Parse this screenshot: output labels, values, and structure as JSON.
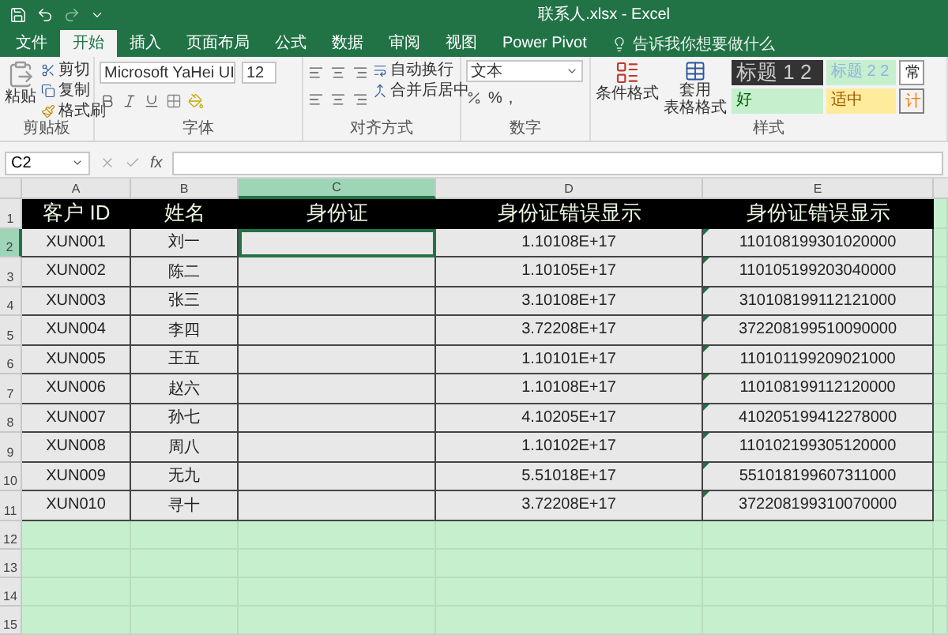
{
  "title_bar": {
    "title": "联系人.xlsx  -  Excel"
  },
  "tabs": [
    {
      "label": "文件",
      "selected": false
    },
    {
      "label": "开始",
      "selected": true
    },
    {
      "label": "插入",
      "selected": false
    },
    {
      "label": "页面布局",
      "selected": false
    },
    {
      "label": "公式",
      "selected": false
    },
    {
      "label": "数据",
      "selected": false
    },
    {
      "label": "审阅",
      "selected": false
    },
    {
      "label": "视图",
      "selected": false
    },
    {
      "label": "Power Pivot",
      "selected": false
    }
  ],
  "tell_me": {
    "placeholder": "告诉我你想要做什么"
  },
  "ribbon": {
    "clipboard": {
      "paste": "粘贴",
      "cut": "剪切",
      "copy": "复制",
      "format_painter": "格式刷",
      "label": "剪贴板"
    },
    "font": {
      "name": "Microsoft YaHei UI",
      "size": "12",
      "label": "字体"
    },
    "alignment": {
      "wrap": "自动换行",
      "merge": "合并后居中",
      "label": "对齐方式"
    },
    "number": {
      "format": "文本",
      "percent": "%",
      "comma": ",",
      "label": "数字"
    },
    "styles": {
      "conditional": "条件格式",
      "table_format": [
        "套用",
        "表格格式"
      ],
      "label": "样式",
      "cells": [
        {
          "label": "标题 1 2",
          "kind": "heading1"
        },
        {
          "label": "标题 2 2",
          "kind": "heading2"
        },
        {
          "label": "常",
          "kind": "normal"
        },
        {
          "label": "好",
          "kind": "good"
        },
        {
          "label": "适中",
          "kind": "neutral"
        },
        {
          "label": "计",
          "kind": "calc"
        }
      ]
    }
  },
  "formula_bar": {
    "name_box": "C2",
    "fx": "fx"
  },
  "sheet": {
    "columns": [
      {
        "label": "A",
        "selected": false
      },
      {
        "label": "B",
        "selected": false
      },
      {
        "label": "C",
        "selected": true
      },
      {
        "label": "D",
        "selected": false
      },
      {
        "label": "E",
        "selected": false
      }
    ],
    "header": {
      "number": "1",
      "cells": [
        "客户 ID",
        "姓名",
        "身份证",
        "身份证错误显示",
        "身份证错误显示"
      ]
    },
    "rows": [
      {
        "number": "2",
        "selected": true,
        "customer_id": "XUN001",
        "name": "刘一",
        "shown_d": "1.10108E+17",
        "shown_e": "110108199301020000",
        "error_flag": true
      },
      {
        "number": "3",
        "selected": false,
        "customer_id": "XUN002",
        "name": "陈二",
        "shown_d": "1.10105E+17",
        "shown_e": "110105199203040000",
        "error_flag": true
      },
      {
        "number": "4",
        "selected": false,
        "customer_id": "XUN003",
        "name": "张三",
        "shown_d": "3.10108E+17",
        "shown_e": "310108199112121000",
        "error_flag": true
      },
      {
        "number": "5",
        "selected": false,
        "customer_id": "XUN004",
        "name": "李四",
        "shown_d": "3.72208E+17",
        "shown_e": "372208199510090000",
        "error_flag": true
      },
      {
        "number": "6",
        "selected": false,
        "customer_id": "XUN005",
        "name": "王五",
        "shown_d": "1.10101E+17",
        "shown_e": "110101199209021000",
        "error_flag": true
      },
      {
        "number": "7",
        "selected": false,
        "customer_id": "XUN006",
        "name": "赵六",
        "shown_d": "1.10108E+17",
        "shown_e": "110108199112120000",
        "error_flag": true
      },
      {
        "number": "8",
        "selected": false,
        "customer_id": "XUN007",
        "name": "孙七",
        "shown_d": "4.10205E+17",
        "shown_e": "410205199412278000",
        "error_flag": true
      },
      {
        "number": "9",
        "selected": false,
        "customer_id": "XUN008",
        "name": "周八",
        "shown_d": "1.10102E+17",
        "shown_e": "110102199305120000",
        "error_flag": true
      },
      {
        "number": "10",
        "selected": false,
        "customer_id": "XUN009",
        "name": "无九",
        "shown_d": "5.51018E+17",
        "shown_e": "551018199607311000",
        "error_flag": true
      },
      {
        "number": "11",
        "selected": false,
        "customer_id": "XUN010",
        "name": "寻十",
        "shown_d": "3.72208E+17",
        "shown_e": "372208199310070000",
        "error_flag": true
      }
    ],
    "empty_rows": [
      "12",
      "13",
      "14",
      "15"
    ]
  }
}
